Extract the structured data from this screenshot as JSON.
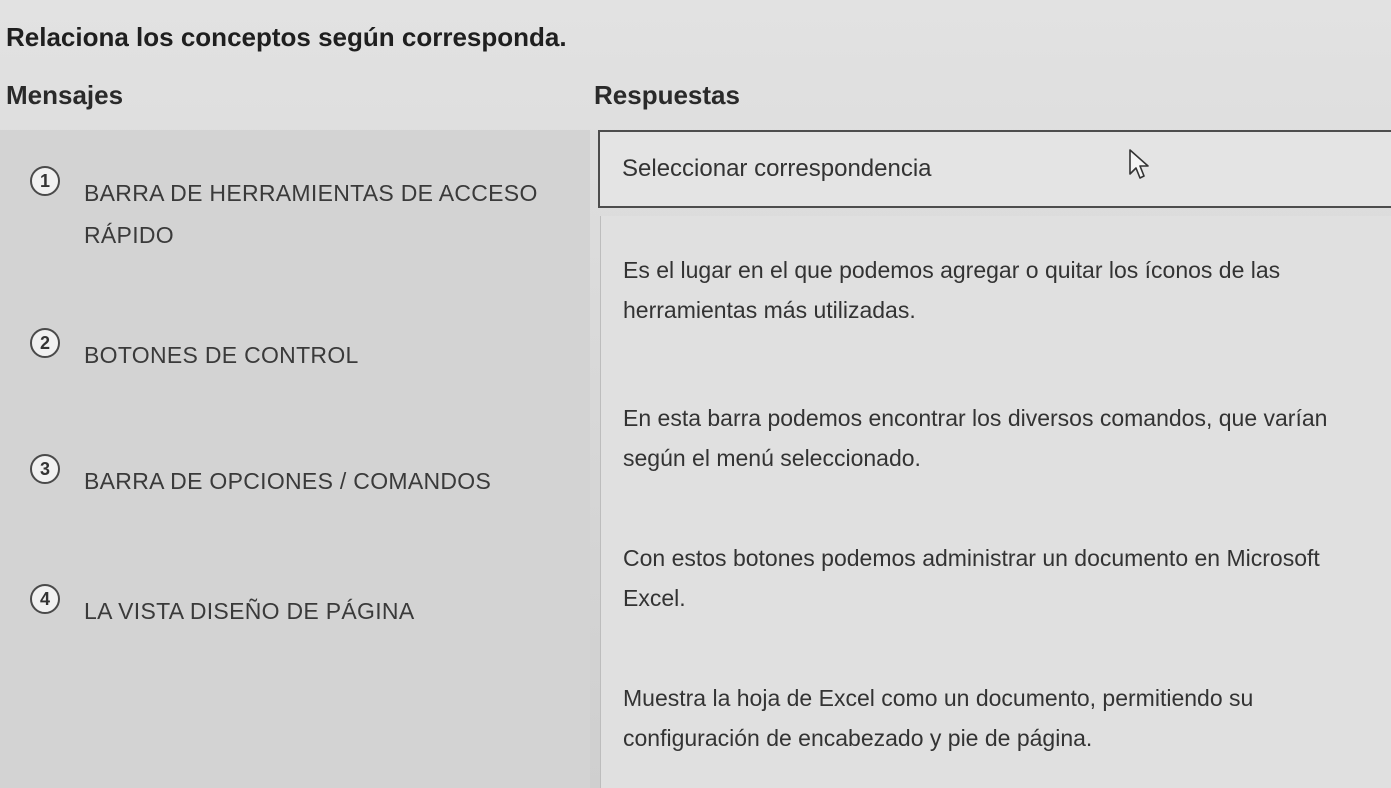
{
  "instruction": "Relaciona los conceptos según corresponda.",
  "columns": {
    "left": "Mensajes",
    "right": "Respuestas"
  },
  "messages": [
    {
      "number": "1",
      "text": "BARRA DE HERRAMIENTAS DE ACCESO RÁPIDO"
    },
    {
      "number": "2",
      "text": "BOTONES DE CONTROL"
    },
    {
      "number": "3",
      "text": "BARRA DE OPCIONES / COMANDOS"
    },
    {
      "number": "4",
      "text": "LA VISTA DISEÑO DE PÁGINA"
    }
  ],
  "select": {
    "placeholder": "Seleccionar correspondencia"
  },
  "answers": [
    "Es el lugar en el que podemos agregar o quitar los íconos de las herramientas más utilizadas.",
    "En esta barra podemos encontrar los diversos comandos, que varían según el menú seleccionado.",
    "Con estos botones podemos administrar un documento en Microsoft Excel.",
    "Muestra la hoja de Excel como un documento, permitiendo su configuración de encabezado y pie de página."
  ],
  "icons": {
    "cursor": "mouse-pointer-icon"
  }
}
